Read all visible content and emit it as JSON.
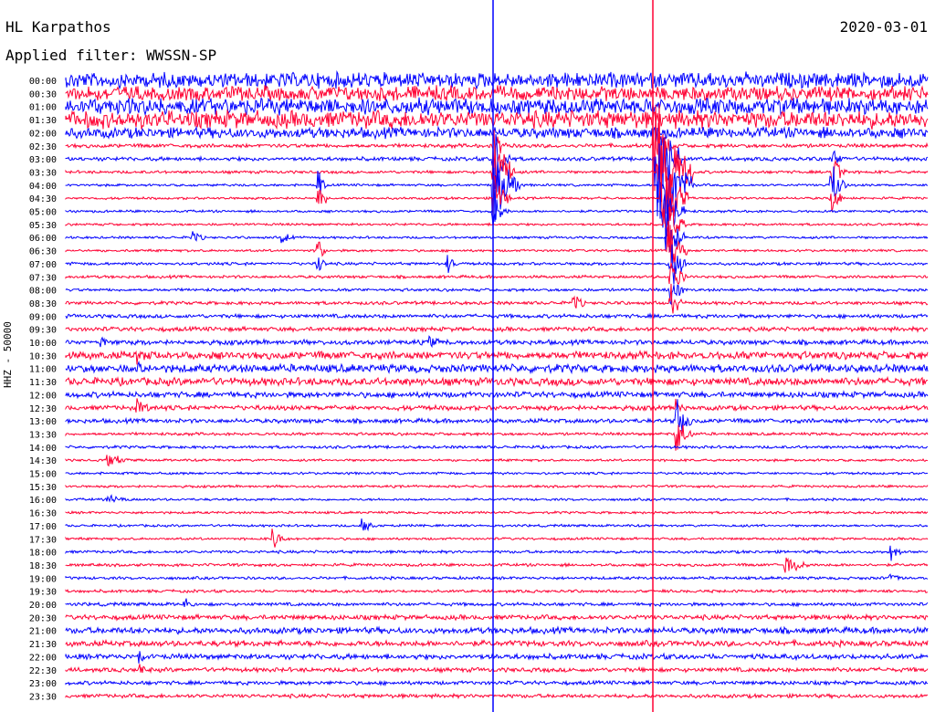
{
  "header": {
    "station": "HL Karpathos",
    "date": "2020-03-01",
    "filter_text": "Applied filter: WWSSN-SP"
  },
  "chart_data": {
    "type": "helicorder",
    "channel_label": "HHZ - 50000",
    "colors": {
      "even_trace": "#0000ff",
      "odd_trace": "#ff0033",
      "background": "#ffffff",
      "text": "#000000"
    },
    "rows": [
      "00:00",
      "00:30",
      "01:00",
      "01:30",
      "02:00",
      "02:30",
      "03:00",
      "03:30",
      "04:00",
      "04:30",
      "05:00",
      "05:30",
      "06:00",
      "06:30",
      "07:00",
      "07:30",
      "08:00",
      "08:30",
      "09:00",
      "09:30",
      "10:00",
      "10:30",
      "11:00",
      "11:30",
      "12:00",
      "12:30",
      "13:00",
      "13:30",
      "14:00",
      "14:30",
      "15:00",
      "15:30",
      "16:00",
      "16:30",
      "17:00",
      "17:30",
      "18:00",
      "18:30",
      "19:00",
      "19:30",
      "20:00",
      "20:30",
      "21:00",
      "21:30",
      "22:00",
      "22:30",
      "23:00",
      "23:30"
    ],
    "noise_level": [
      3.2,
      3.0,
      3.4,
      3.6,
      2.2,
      0.8,
      0.8,
      0.6,
      0.5,
      0.5,
      0.5,
      0.5,
      0.5,
      0.5,
      0.6,
      0.6,
      0.6,
      0.7,
      0.8,
      0.9,
      1.0,
      1.6,
      1.7,
      1.6,
      1.2,
      1.0,
      0.9,
      0.6,
      0.6,
      0.5,
      0.5,
      0.5,
      0.5,
      0.5,
      0.5,
      0.5,
      0.6,
      0.6,
      0.6,
      0.6,
      0.7,
      1.0,
      1.3,
      1.2,
      1.1,
      0.9,
      0.8,
      0.8
    ]
  }
}
